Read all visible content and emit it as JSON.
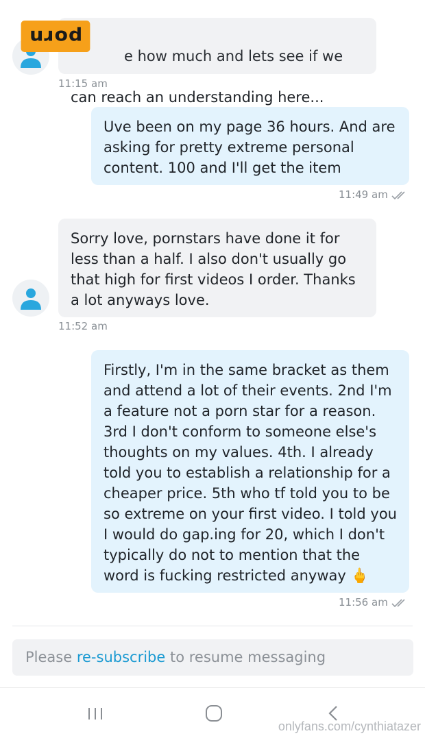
{
  "watermark_badge": "porn",
  "messages": [
    {
      "direction": "in",
      "text": "e how much and lets see if we can reach an understanding here...",
      "time": "11:15 am"
    },
    {
      "direction": "out",
      "text": "Uve been on my page 36 hours. And are asking for pretty extreme personal content. 100 and I'll get the item",
      "time": "11:49 am"
    },
    {
      "direction": "in",
      "text": "Sorry love, pornstars have done it for less than a half. I also don't usually go that high for first videos I order. Thanks a lot anyways love.",
      "time": "11:52 am"
    },
    {
      "direction": "out",
      "text": "Firstly, I'm in the same bracket as them and attend a lot of their events. 2nd I'm a feature not a porn star for a reason. 3rd I don't conform to someone else's thoughts on my values. 4th. I already told you to establish a relationship for a cheaper price. 5th who tf told you to be so extreme on your first video. I told you I would do gap.ing for 20, which I don't typically do not to mention that the word is fucking restricted anyway 🖕",
      "time": "11:56 am"
    }
  ],
  "composer": {
    "prefix": "Please ",
    "link": "re-subscribe",
    "suffix": " to resume messaging"
  },
  "nav": {
    "recents_icon": "recents-icon",
    "home_icon": "home-icon",
    "back_icon": "back-icon"
  },
  "footer_watermark": "onlyfans.com/cynthiatazer",
  "colors": {
    "incoming_bubble": "#f1f2f4",
    "outgoing_bubble": "#e3f3fd",
    "link": "#1a9ad2",
    "avatar": "#29a7de",
    "badge": "#f6a01a"
  }
}
